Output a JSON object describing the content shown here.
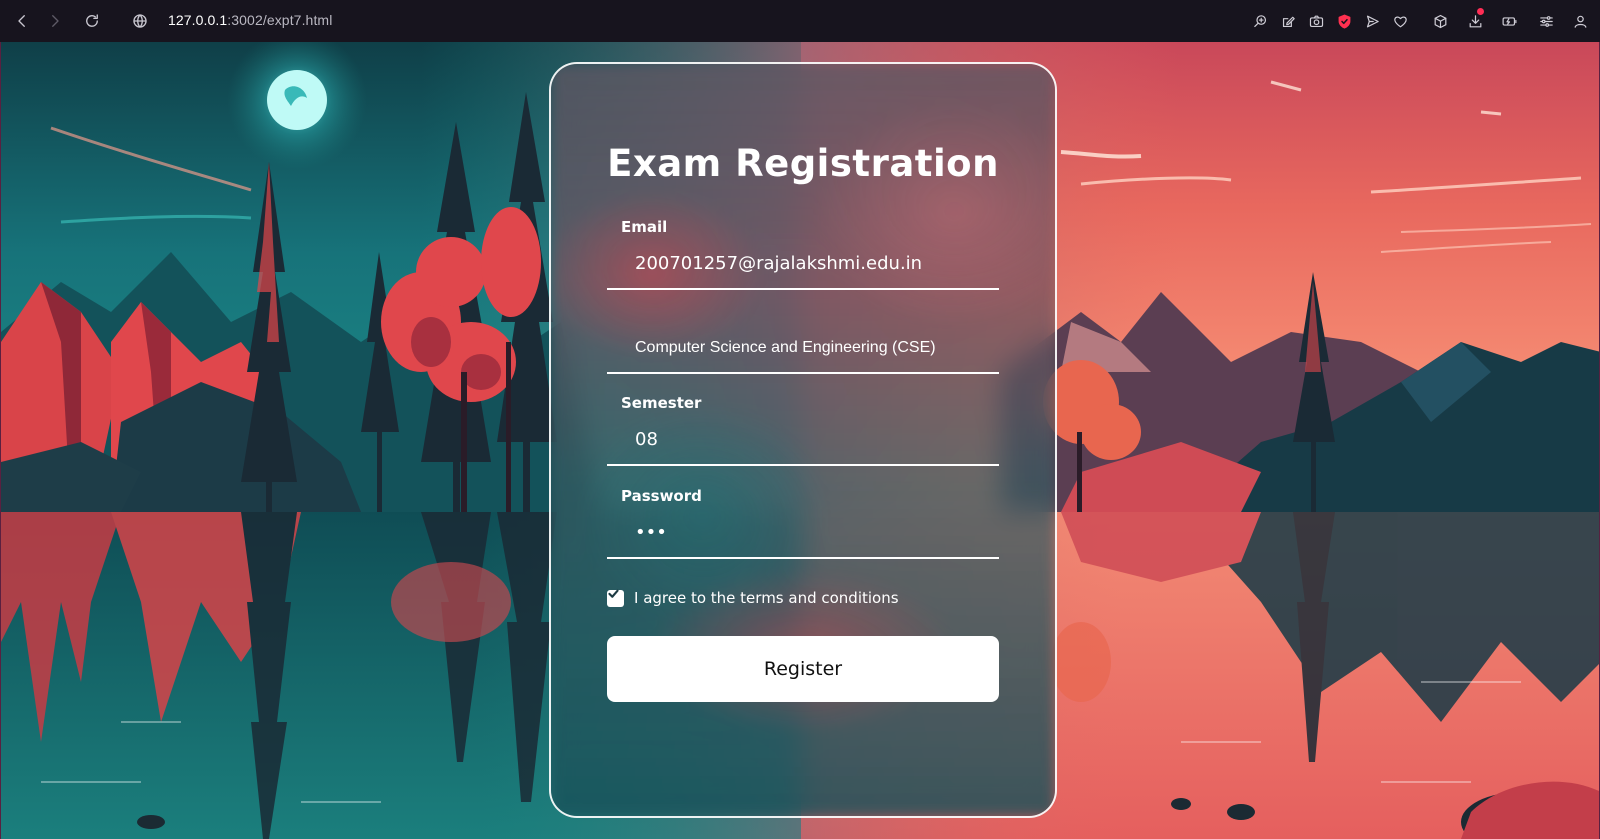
{
  "browser": {
    "url_host": "127.0.0.1",
    "url_path": ":3002/expt7.html"
  },
  "form": {
    "title": "Exam Registration",
    "email": {
      "label": "Email",
      "value": "200701257@rajalakshmi.edu.in"
    },
    "department": {
      "selected": "Computer Science and Engineering (CSE)"
    },
    "semester": {
      "label": "Semester",
      "value": "08"
    },
    "password": {
      "label": "Password",
      "value": "abc"
    },
    "agree": {
      "label": "I agree to the terms and conditions",
      "checked": true
    },
    "submit_label": "Register"
  },
  "colors": {
    "chrome_bg": "#17141e",
    "teal_sky": "#1f8a86",
    "coral_sky": "#f08a78",
    "card_border": "#ffffff",
    "button_bg": "#ffffff"
  }
}
